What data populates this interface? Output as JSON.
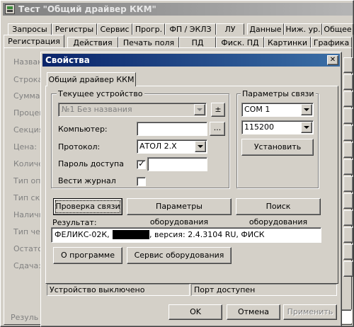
{
  "main_window": {
    "title": "Тест \"Общий драйвер ККМ\"",
    "tabs_row1": [
      "Запросы",
      "Регистры",
      "Сервис",
      "Прогр.",
      "ФП / ЭКЛЗ",
      "ЛУ",
      "Данные",
      "Ниж. ур.",
      "Общее"
    ],
    "tabs_row2": [
      "Регистрация",
      "Действия",
      "Печать поля",
      "ПД",
      "Фиск. ПД",
      "Картинки",
      "Графика"
    ],
    "side_labels": [
      "Назван",
      "Строка",
      "Сумма:",
      "Процен",
      "Секция",
      "Цена:",
      "Количе",
      "Тип опл",
      "Тип ски",
      "Наличн",
      "Тип чек",
      "Остаток",
      "Сдача:"
    ],
    "bottom_label": "Резуль"
  },
  "dialog": {
    "title": "Свойства",
    "close_glyph": "✕",
    "tab": "Общий драйвер ККМ",
    "device_group": {
      "title": "Текущее устройство",
      "device_value": "№1 Без названия",
      "plusminus": "±",
      "computer_label": "Компьютер:",
      "computer_value": "",
      "browse_label": "...",
      "protocol_label": "Протокол:",
      "protocol_value": "АТОЛ 2.X",
      "password_label": "Пароль доступа",
      "password_checked": true,
      "password_value": "",
      "log_label": "Вести журнал",
      "log_checked": false
    },
    "conn_group": {
      "title": "Параметры связи",
      "port_value": "COM 1",
      "baud_value": "115200",
      "set_button": "Установить"
    },
    "buttons": {
      "check": "Проверка связи",
      "params": "Параметры оборудования",
      "search": "Поиск оборудования",
      "about": "О программе",
      "service": "Сервис оборудования",
      "ok": "OK",
      "cancel": "Отмена",
      "apply": "Применить"
    },
    "result_label": "Результат:",
    "result": {
      "prefix": "ФЕЛИКС-02К, ",
      "suffix": ", версия: 2.4.3104 RU, ФИСК"
    },
    "status": {
      "left": "Устройство выключено",
      "right": "Порт доступен"
    }
  },
  "colors": {
    "titlebar_active": "#0a246a",
    "titlebar_inactive": "#808080",
    "face": "#d4d0c8",
    "desktop": "#3a6ea5"
  }
}
